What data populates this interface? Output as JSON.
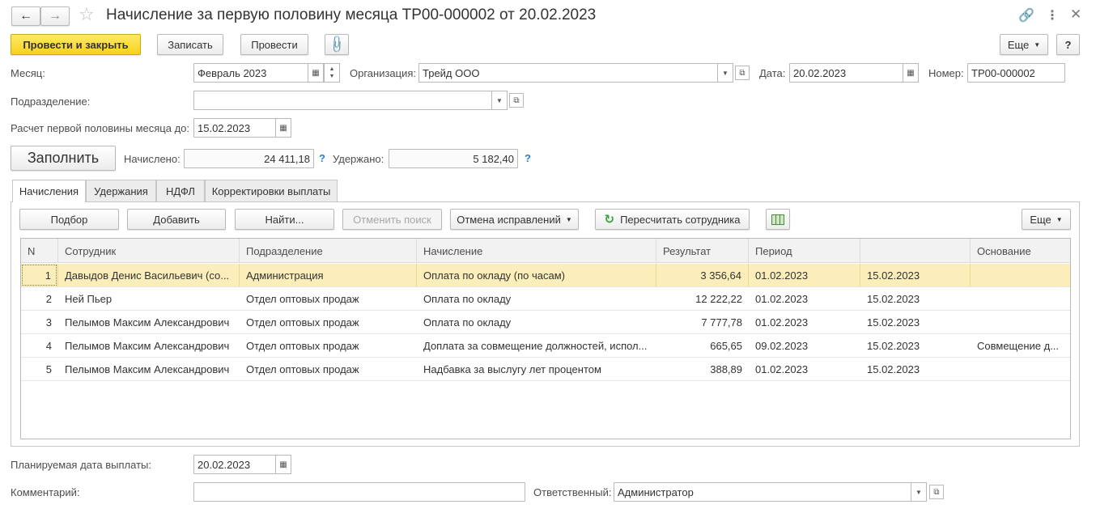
{
  "window": {
    "title": "Начисление за первую половину месяца ТР00-000002 от 20.02.2023",
    "back_icon": "arrow-left-icon",
    "forward_icon": "arrow-right-icon",
    "star_icon": "star-icon",
    "link_icon": "link-icon",
    "menu_icon": "more-vertical-icon",
    "close_icon": "close-icon"
  },
  "toolbar": {
    "post_close": "Провести и закрыть",
    "save": "Записать",
    "post": "Провести",
    "attach_icon": "paperclip-icon",
    "more": "Еще",
    "help": "?"
  },
  "form": {
    "month_label": "Месяц:",
    "month_value": "Февраль 2023",
    "org_label": "Организация:",
    "org_value": "Трейд ООО",
    "date_label": "Дата:",
    "date_value": "20.02.2023",
    "number_label": "Номер:",
    "number_value": "ТР00-000002",
    "dept_label": "Подразделение:",
    "dept_value": "",
    "calc_until_label": "Расчет первой половины месяца до:",
    "calc_until_value": "15.02.2023",
    "fill_button": "Заполнить",
    "accrued_label": "Начислено:",
    "accrued_value": "24 411,18",
    "withheld_label": "Удержано:",
    "withheld_value": "5 182,40",
    "help_mark": "?"
  },
  "tabs": [
    {
      "label": "Начисления",
      "active": true
    },
    {
      "label": "Удержания",
      "active": false
    },
    {
      "label": "НДФЛ",
      "active": false
    },
    {
      "label": "Корректировки выплаты",
      "active": false
    }
  ],
  "table_toolbar": {
    "pick": "Подбор",
    "add": "Добавить",
    "find": "Найти...",
    "cancel_search": "Отменить поиск",
    "cancel_corrections": "Отмена исправлений",
    "recalc": "Пересчитать сотрудника",
    "more": "Еще"
  },
  "table": {
    "columns": [
      "N",
      "Сотрудник",
      "Подразделение",
      "Начисление",
      "Результат",
      "Период",
      "",
      "Основание"
    ],
    "rows": [
      {
        "n": "1",
        "employee": "Давыдов Денис Васильевич (со...",
        "dept": "Администрация",
        "accrual": "Оплата по окладу (по часам)",
        "result": "3 356,64",
        "from": "01.02.2023",
        "to": "15.02.2023",
        "basis": ""
      },
      {
        "n": "2",
        "employee": "Ней Пьер",
        "dept": "Отдел оптовых продаж",
        "accrual": "Оплата по окладу",
        "result": "12 222,22",
        "from": "01.02.2023",
        "to": "15.02.2023",
        "basis": ""
      },
      {
        "n": "3",
        "employee": "Пелымов Максим Александрович",
        "dept": "Отдел оптовых продаж",
        "accrual": "Оплата по окладу",
        "result": "7 777,78",
        "from": "01.02.2023",
        "to": "15.02.2023",
        "basis": ""
      },
      {
        "n": "4",
        "employee": "Пелымов Максим Александрович",
        "dept": "Отдел оптовых продаж",
        "accrual": "Доплата за совмещение должностей, испол...",
        "result": "665,65",
        "from": "09.02.2023",
        "to": "15.02.2023",
        "basis": "Совмещение д..."
      },
      {
        "n": "5",
        "employee": "Пелымов Максим Александрович",
        "dept": "Отдел оптовых продаж",
        "accrual": "Надбавка за выслугу лет процентом",
        "result": "388,89",
        "from": "01.02.2023",
        "to": "15.02.2023",
        "basis": ""
      }
    ]
  },
  "footer": {
    "pay_date_label": "Планируемая дата выплаты:",
    "pay_date_value": "20.02.2023",
    "comment_label": "Комментарий:",
    "comment_value": "",
    "responsible_label": "Ответственный:",
    "responsible_value": "Администратор"
  },
  "colors": {
    "primary_button": "#f8d21b",
    "selected_row": "#fbeeba",
    "help_mark": "#2a7fd0",
    "recalc_icon": "#3aa33a"
  }
}
